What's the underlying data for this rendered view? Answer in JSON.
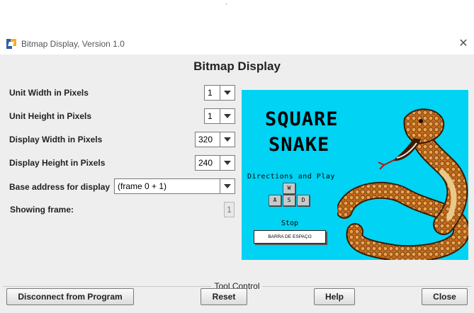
{
  "top_mark": "·",
  "window": {
    "title": "Bitmap Display, Version 1.0",
    "close_icon": "close-icon"
  },
  "heading": "Bitmap Display",
  "settings": {
    "unit_width": {
      "label": "Unit Width in Pixels",
      "value": "1"
    },
    "unit_height": {
      "label": "Unit Height in Pixels",
      "value": "1"
    },
    "display_width": {
      "label": "Display Width in Pixels",
      "value": "320"
    },
    "display_height": {
      "label": "Display Height in Pixels",
      "value": "240"
    },
    "base_address": {
      "label": "Base address for display",
      "value": "(frame 0 + 1)"
    },
    "showing_frame": {
      "label": "Showing frame:",
      "value": "1"
    }
  },
  "game": {
    "title_line1": "SQUARE",
    "title_line2": "SNAKE",
    "directions": "Directions and Play",
    "keys": {
      "w": "W",
      "a": "A",
      "s": "S",
      "d": "D"
    },
    "stop": "Stop",
    "space_button": "BARRA DE ESPAÇO",
    "background_color": "#00d3f3"
  },
  "tool_control": {
    "label": "Tool Control",
    "disconnect": "Disconnect from Program",
    "reset": "Reset",
    "help": "Help",
    "close": "Close"
  }
}
